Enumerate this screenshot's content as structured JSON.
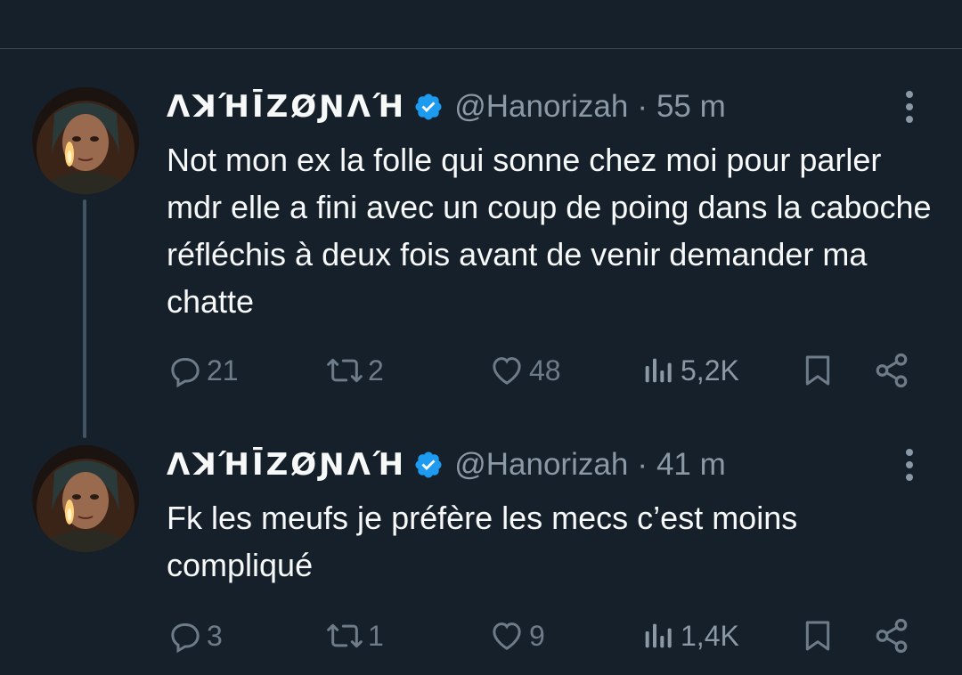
{
  "tweets": [
    {
      "display_name": "ΛꓘΉĪZØƝΛΉ",
      "handle": "@Hanorizah",
      "separator": "·",
      "time": "55 m",
      "text": "Not mon ex la folle qui sonne chez moi pour parler mdr elle a fini avec un coup de poing dans la caboche réfléchis à deux fois avant de venir demander ma chatte",
      "replies": "21",
      "reposts": "2",
      "likes": "48",
      "views": "5,2K"
    },
    {
      "display_name": "ΛꓘΉĪZØƝΛΉ",
      "handle": "@Hanorizah",
      "separator": "·",
      "time": "41 m",
      "text": "Fk les meufs je préfère les mecs c’est moins compliqué",
      "replies": "3",
      "reposts": "1",
      "likes": "9",
      "views": "1,4K"
    }
  ],
  "colors": {
    "background": "#15202b",
    "text_primary": "#f7f9f9",
    "text_secondary": "#8b98a5",
    "icon": "#6e7c89",
    "verified": "#1d9bf0",
    "thread_line": "#425364"
  },
  "icons": {
    "verified": "verified-badge-icon",
    "more": "more-vertical-icon",
    "reply": "reply-icon",
    "repost": "repost-icon",
    "like": "heart-icon",
    "views": "views-icon",
    "bookmark": "bookmark-icon",
    "share": "share-icon"
  }
}
